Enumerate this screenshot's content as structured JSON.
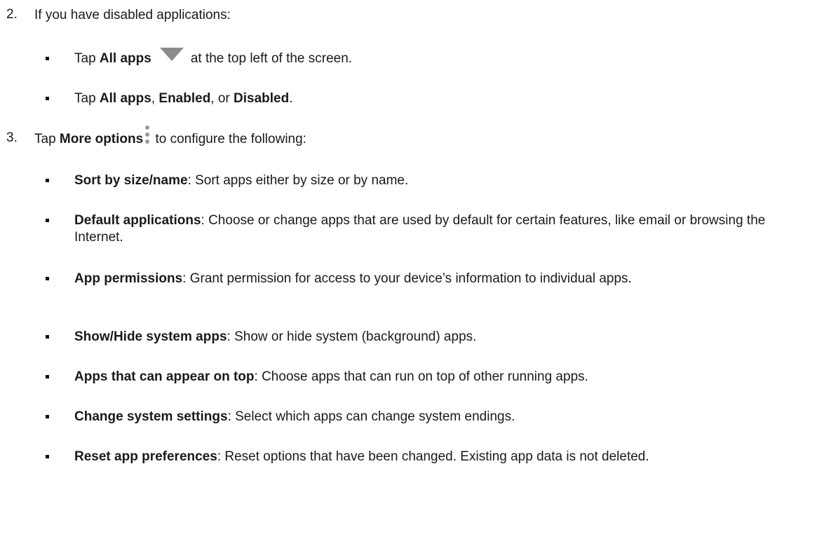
{
  "step2": {
    "number": "2.",
    "text": "If you have disabled applications:",
    "bullets": [
      {
        "pre": "Tap ",
        "bold": "All apps",
        "icon": "dropdown-triangle-icon",
        "post": "at the top left of the screen."
      },
      {
        "pre": "Tap ",
        "bold1": "All apps",
        "mid1": ", ",
        "bold2": "Enabled",
        "mid2": ", or ",
        "bold3": "Disabled",
        "post": "."
      }
    ]
  },
  "step3": {
    "number": "3.",
    "pre": "Tap ",
    "bold": "More options",
    "icon": "more-options-icon",
    "post": " to configure the following:",
    "items": [
      {
        "term": "Sort by size/name",
        "desc": ": Sort apps either by size or by name."
      },
      {
        "term": "Default applications",
        "desc": ": Choose or change apps that are used by default for certain features, like email or browsing the Internet."
      },
      {
        "term": "App permissions",
        "desc": ": Grant permission for access to your device’s information to individual apps."
      },
      {
        "term": "Show/Hide system apps",
        "desc": ": Show or hide system (background) apps."
      },
      {
        "term": "Apps that can appear on top",
        "desc": ": Choose apps that can run on top of other running apps."
      },
      {
        "term": "Change system settings",
        "desc": ": Select which apps can change system endings."
      },
      {
        "term": "Reset app preferences",
        "desc": ": Reset options that have been changed. Existing app data is not deleted."
      }
    ]
  },
  "colors": {
    "text": "#1a1a1a",
    "icon_gray": "#8c8c8c"
  }
}
